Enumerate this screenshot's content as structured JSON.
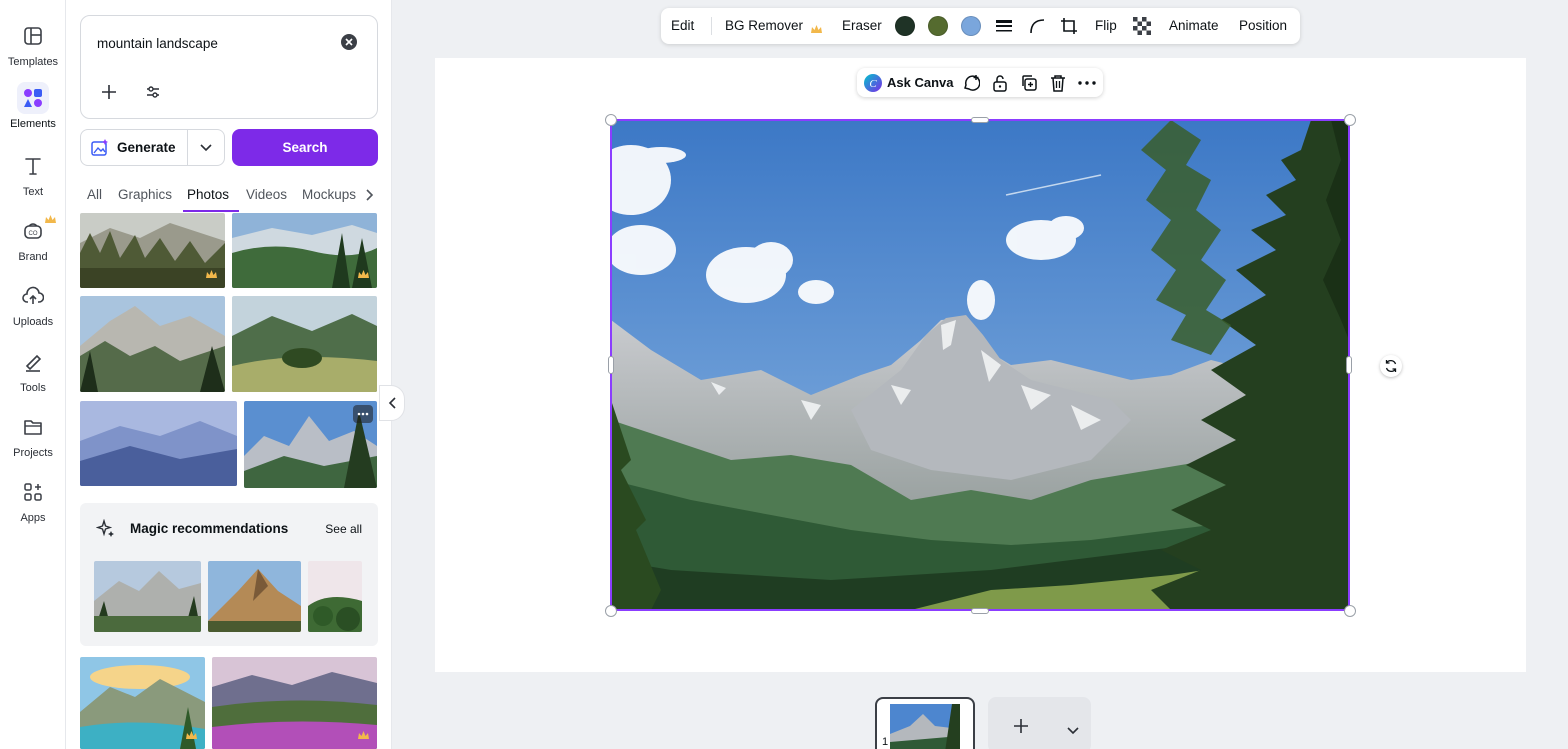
{
  "rail": {
    "items": [
      {
        "label": "Templates",
        "icon": "templates-icon"
      },
      {
        "label": "Elements",
        "icon": "elements-icon",
        "active": true
      },
      {
        "label": "Text",
        "icon": "text-icon"
      },
      {
        "label": "Brand",
        "icon": "brand-icon"
      },
      {
        "label": "Uploads",
        "icon": "uploads-icon"
      },
      {
        "label": "Tools",
        "icon": "tools-icon"
      },
      {
        "label": "Projects",
        "icon": "projects-icon"
      },
      {
        "label": "Apps",
        "icon": "apps-icon"
      }
    ]
  },
  "search": {
    "query": "mountain landscape",
    "generate_label": "Generate",
    "search_label": "Search"
  },
  "tabs": [
    {
      "label": "All"
    },
    {
      "label": "Graphics"
    },
    {
      "label": "Photos",
      "active": true
    },
    {
      "label": "Videos"
    },
    {
      "label": "Mockups"
    }
  ],
  "magic": {
    "title": "Magic recommendations",
    "see_all": "See all"
  },
  "toolbar": {
    "edit": "Edit",
    "bg_remover": "BG Remover",
    "eraser": "Eraser",
    "swatches": [
      "#1f3326",
      "#556b2f",
      "#7aa6dc"
    ],
    "flip": "Flip",
    "animate": "Animate",
    "position": "Position"
  },
  "context_bar": {
    "ask_canva": "Ask Canva"
  },
  "pages": {
    "current": "1"
  },
  "colors": {
    "accent": "#7d2ae8",
    "selection": "#8b3dff"
  }
}
